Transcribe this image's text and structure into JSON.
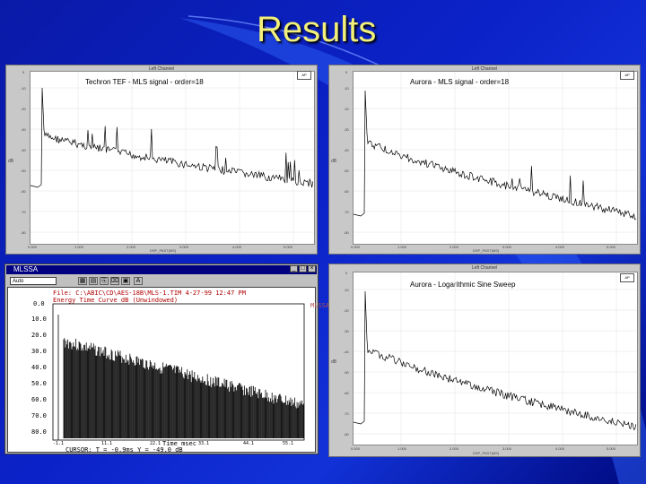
{
  "slide": {
    "title": "Results"
  },
  "panels": [
    {
      "header": "Left Channel",
      "title": "Techron TEF - MLS signal - order=18",
      "badge": "AP",
      "xlabel": "DSP_PAST(MS)",
      "xticks": [
        "0.000",
        "1.000",
        "2.000",
        "3.000",
        "4.000",
        "5.000"
      ],
      "yticks": [
        "0",
        "-10",
        "-20",
        "-30",
        "-40",
        "-50",
        "-60",
        "-70",
        "-80",
        "-90"
      ]
    },
    {
      "header": "Left Channel",
      "title": "Aurora - MLS signal - order=18",
      "badge": "AP",
      "xlabel": "DSP_PAST(MS)",
      "xticks": [
        "0.000",
        "1.000",
        "2.000",
        "3.000",
        "4.000",
        "5.000"
      ],
      "yticks": [
        "0",
        "-10",
        "-20",
        "-30",
        "-40",
        "-50",
        "-60",
        "-70",
        "-80",
        "-90"
      ]
    },
    {
      "header": "Left Channel",
      "title": "Aurora - Logarithmic Sine Sweep",
      "badge": "AP",
      "xlabel": "DSP_PAST(MS)",
      "xticks": [
        "0.000",
        "1.000",
        "2.000",
        "3.000",
        "4.000",
        "5.000"
      ],
      "yticks": [
        "0",
        "-10",
        "-20",
        "-30",
        "-40",
        "-50",
        "-60",
        "-70",
        "-80",
        "-90"
      ]
    }
  ],
  "mlssa": {
    "title": "MLSSA",
    "combo": "Auto",
    "file_line": "File: C:\\ABIC\\CD\\AES-18B\\MLS-1.TIM  4-27-99  12:47 PM",
    "plot_line": "Energy Time Curve   dB (Unwindowed)",
    "side_text": "MLSSA",
    "yticks": [
      "0.0",
      "10.0",
      "20.0",
      "30.0",
      "40.0",
      "50.0",
      "60.0",
      "70.0",
      "80.0"
    ],
    "xticks": [
      "-1.1",
      "11.1",
      "22.1",
      "33.1",
      "44.1",
      "55.1"
    ],
    "xlabel": "Time   msec",
    "cursor_line": "CURSOR:  T  = -0.9ms   Y = -49.0 dB"
  }
}
